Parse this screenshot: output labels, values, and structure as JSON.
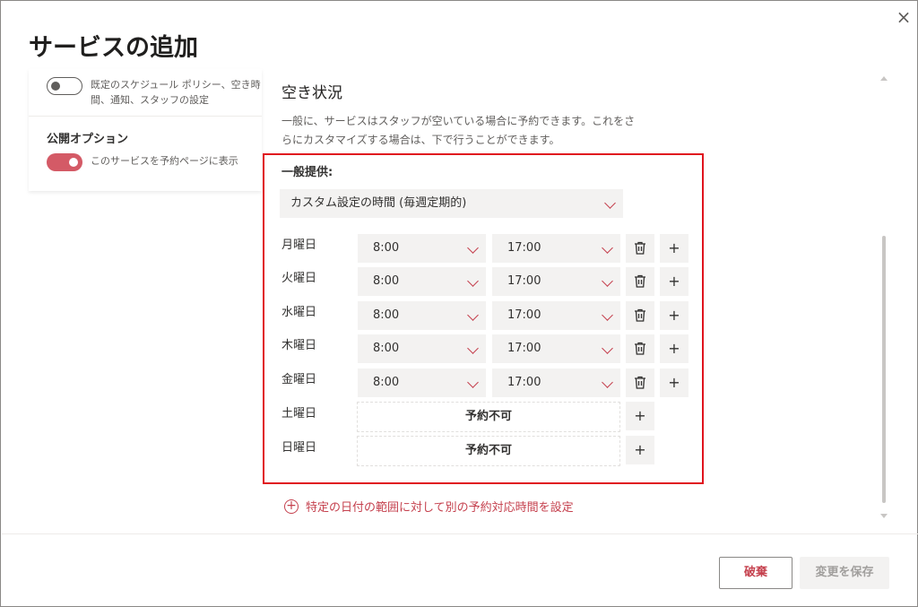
{
  "dialog": {
    "title": "サービスの追加",
    "close_icon": "×"
  },
  "left_panel": {
    "default_policy_text_line1": "既定のスケジュール ポリシー、空き時",
    "default_policy_text_line2": "間、通知、スタッフの設定",
    "publish_section_label": "公開オプション",
    "publish_toggle_text": "このサービスを予約ページに表示",
    "default_policy_toggle": "off",
    "publish_toggle": "on"
  },
  "availability": {
    "title": "空き状況",
    "description_line1": "一般に、サービスはスタッフが空いている場合に予約できます。これをさ",
    "description_line2": "らにカスタマイズする場合は、下で行うことができます。",
    "general_label": "一般提供:",
    "schedule_type": "カスタム設定の時間 (毎週定期的)",
    "days": [
      {
        "label": "月曜日",
        "start": "8:00",
        "end": "17:00",
        "available": true
      },
      {
        "label": "火曜日",
        "start": "8:00",
        "end": "17:00",
        "available": true
      },
      {
        "label": "水曜日",
        "start": "8:00",
        "end": "17:00",
        "available": true
      },
      {
        "label": "木曜日",
        "start": "8:00",
        "end": "17:00",
        "available": true
      },
      {
        "label": "金曜日",
        "start": "8:00",
        "end": "17:00",
        "available": true
      },
      {
        "label": "土曜日",
        "unavailable_text": "予約不可",
        "available": false
      },
      {
        "label": "日曜日",
        "unavailable_text": "予約不可",
        "available": false
      }
    ],
    "add_icon": "+",
    "add_date_range_link": "特定の日付の範囲に対して別の予約対応時間を設定"
  },
  "footer": {
    "discard_label": "破棄",
    "save_label": "変更を保存"
  },
  "colors": {
    "accent": "#c5414e",
    "toggle_on": "#d45a66",
    "highlight_box": "#e0141e"
  }
}
